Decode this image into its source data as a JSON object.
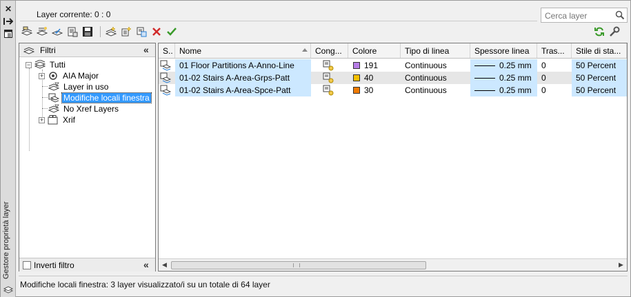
{
  "window": {
    "side_title": "Gestore proprietà layer",
    "current_layer": "Layer corrente: 0 : 0"
  },
  "search": {
    "placeholder": "Cerca layer"
  },
  "toolbar": {
    "left_icons": [
      "new-property-filter-icon",
      "new-group-filter-icon",
      "layer-states-manager-icon",
      "new-layer-vp-frozen-icon",
      "save-icon"
    ],
    "right_icons": [
      "new-layer-icon",
      "new-layer-frozen-vp-icon",
      "delete-layer-icon",
      "set-current-icon"
    ],
    "far_right_icons": [
      "refresh-icon",
      "settings-icon"
    ]
  },
  "filter_pane": {
    "title": "Filtri",
    "tree": [
      {
        "label": "Tutti",
        "level": 0,
        "expander": "−"
      },
      {
        "label": "AIA Major",
        "level": 1,
        "expander": "+"
      },
      {
        "label": "Layer in uso",
        "level": 1,
        "expander": ""
      },
      {
        "label": "Modifiche locali finestra",
        "level": 1,
        "expander": "",
        "selected": true
      },
      {
        "label": "No Xref Layers",
        "level": 1,
        "expander": ""
      },
      {
        "label": "Xrif",
        "level": 1,
        "expander": "+"
      }
    ],
    "invert_label": "Inverti filtro",
    "invert_checked": false
  },
  "grid": {
    "columns": [
      "S..",
      "Nome",
      "Cong...",
      "Colore",
      "Tipo di linea",
      "Spessore linea",
      "Tras...",
      "Stile di sta..."
    ],
    "sort_column": "Nome",
    "rows": [
      {
        "name": "01 Floor Partitions A-Anno-Line",
        "color_hex": "#b87ee8",
        "color": "191",
        "linetype": "Continuous",
        "lineweight": "0.25 mm",
        "transparency": "0",
        "plot_style": "50 Percent"
      },
      {
        "name": "01-02 Stairs A-Area-Grps-Patt",
        "color_hex": "#f5c000",
        "color": "40",
        "linetype": "Continuous",
        "lineweight": "0.25 mm",
        "transparency": "0",
        "plot_style": "50 Percent"
      },
      {
        "name": "01-02 Stairs A-Area-Spce-Patt",
        "color_hex": "#f07b00",
        "color": "30",
        "linetype": "Continuous",
        "lineweight": "0.25 mm",
        "transparency": "0",
        "plot_style": "50 Percent"
      }
    ]
  },
  "status_bar": {
    "text": "Modifiche locali finestra: 3 layer visualizzato/i su un totale di 64 layer"
  }
}
